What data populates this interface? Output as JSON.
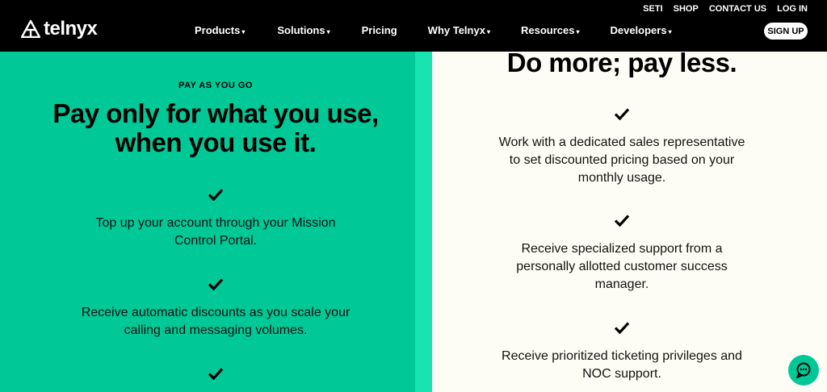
{
  "header": {
    "logo_text": "telnyx",
    "utility_links": [
      "SETI",
      "SHOP",
      "CONTACT US",
      "LOG IN"
    ],
    "nav": [
      {
        "label": "Products",
        "caret": true
      },
      {
        "label": "Solutions",
        "caret": true
      },
      {
        "label": "Pricing",
        "caret": false
      },
      {
        "label": "Why Telnyx",
        "caret": true
      },
      {
        "label": "Resources",
        "caret": true
      },
      {
        "label": "Developers",
        "caret": true
      }
    ],
    "signup_label": "SIGN UP",
    "caret_glyph": "▾"
  },
  "left": {
    "eyebrow": "PAY AS YOU GO",
    "title_line1": "Pay only for what you use,",
    "title_line2": "when you use it.",
    "features": [
      {
        "line1": "Top up your account through your Mission",
        "line2": "Control Portal."
      },
      {
        "line1": "Receive automatic discounts as you scale your",
        "line2": "calling and messaging volumes."
      }
    ]
  },
  "right": {
    "title": "Do more; pay less.",
    "features": [
      {
        "lines": [
          "Work with a dedicated sales representative",
          "to set discounted pricing based on your",
          "monthly usage."
        ]
      },
      {
        "lines": [
          "Receive specialized support from a",
          "personally allotted customer success",
          "manager."
        ]
      },
      {
        "lines": [
          "Receive prioritized ticketing privileges and",
          "NOC support."
        ]
      }
    ]
  },
  "colors": {
    "green": "#00c896",
    "strip": "#19e3b0",
    "cream": "#fefdf5",
    "black": "#000000"
  },
  "icons": {
    "check": "check-icon",
    "chat": "chat-icon",
    "logo": "telnyx-logo-icon"
  }
}
